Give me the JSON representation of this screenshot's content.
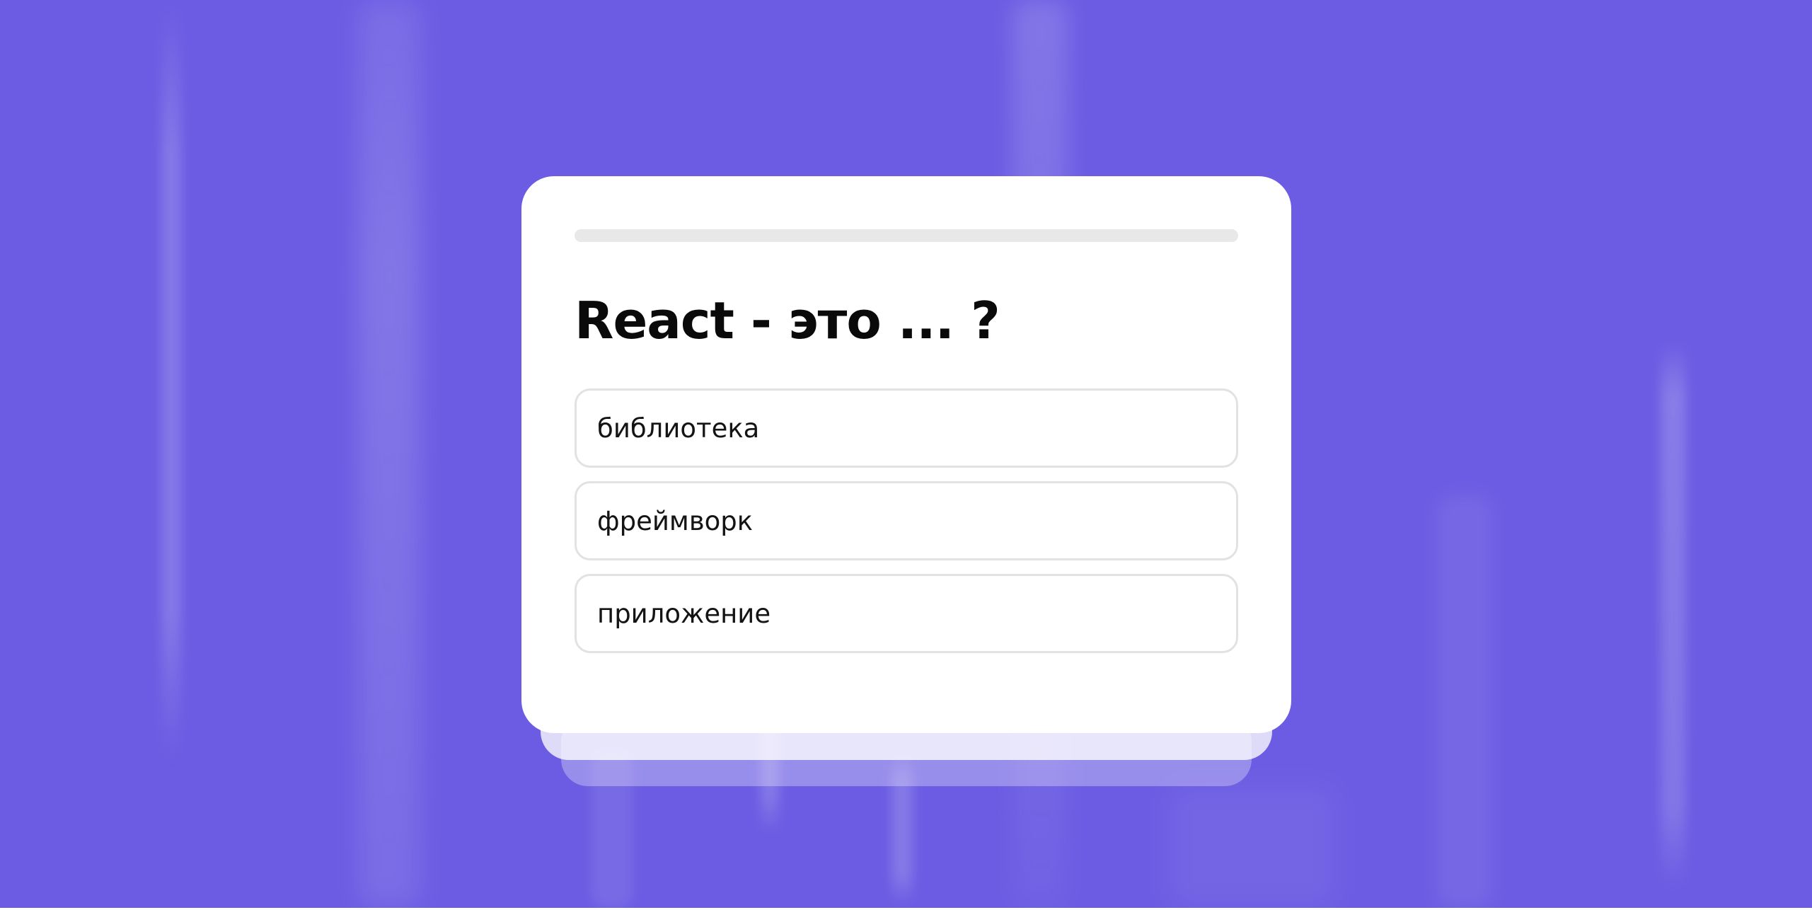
{
  "quiz": {
    "progress_fraction": 0,
    "question": "React - это ... ?",
    "answers": [
      {
        "label": "библиотека"
      },
      {
        "label": "фреймворк"
      },
      {
        "label": "приложение"
      }
    ]
  },
  "colors": {
    "background": "#6b5ce3",
    "card": "#ffffff",
    "progress_track": "#e8e8e8",
    "answer_border": "#e2e2e2",
    "text": "#0a0a0a"
  }
}
